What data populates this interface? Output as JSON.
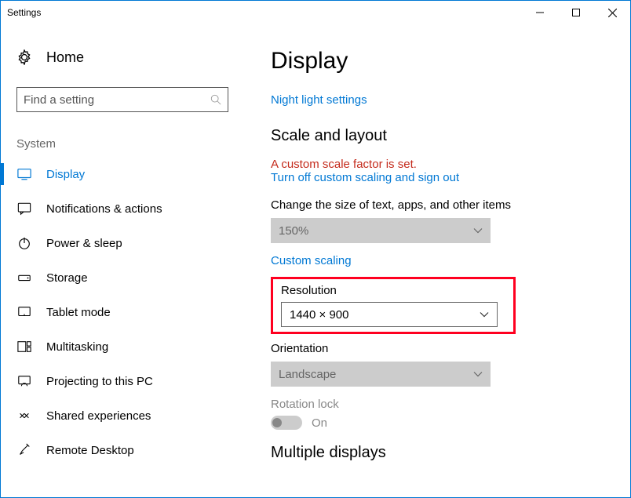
{
  "window": {
    "title": "Settings"
  },
  "sidebar": {
    "home": "Home",
    "search_placeholder": "Find a setting",
    "section": "System",
    "items": [
      {
        "label": "Display",
        "selected": true
      },
      {
        "label": "Notifications & actions"
      },
      {
        "label": "Power & sleep"
      },
      {
        "label": "Storage"
      },
      {
        "label": "Tablet mode"
      },
      {
        "label": "Multitasking"
      },
      {
        "label": "Projecting to this PC"
      },
      {
        "label": "Shared experiences"
      },
      {
        "label": "Remote Desktop"
      }
    ]
  },
  "main": {
    "title": "Display",
    "night_light_link": "Night light settings",
    "scale_heading": "Scale and layout",
    "warning": "A custom scale factor is set.",
    "turn_off_link": "Turn off custom scaling and sign out",
    "size_label": "Change the size of text, apps, and other items",
    "size_value": "150%",
    "custom_scaling_link": "Custom scaling",
    "resolution_label": "Resolution",
    "resolution_value": "1440 × 900",
    "orientation_label": "Orientation",
    "orientation_value": "Landscape",
    "rotation_label": "Rotation lock",
    "rotation_state": "On",
    "multiple_heading": "Multiple displays"
  }
}
